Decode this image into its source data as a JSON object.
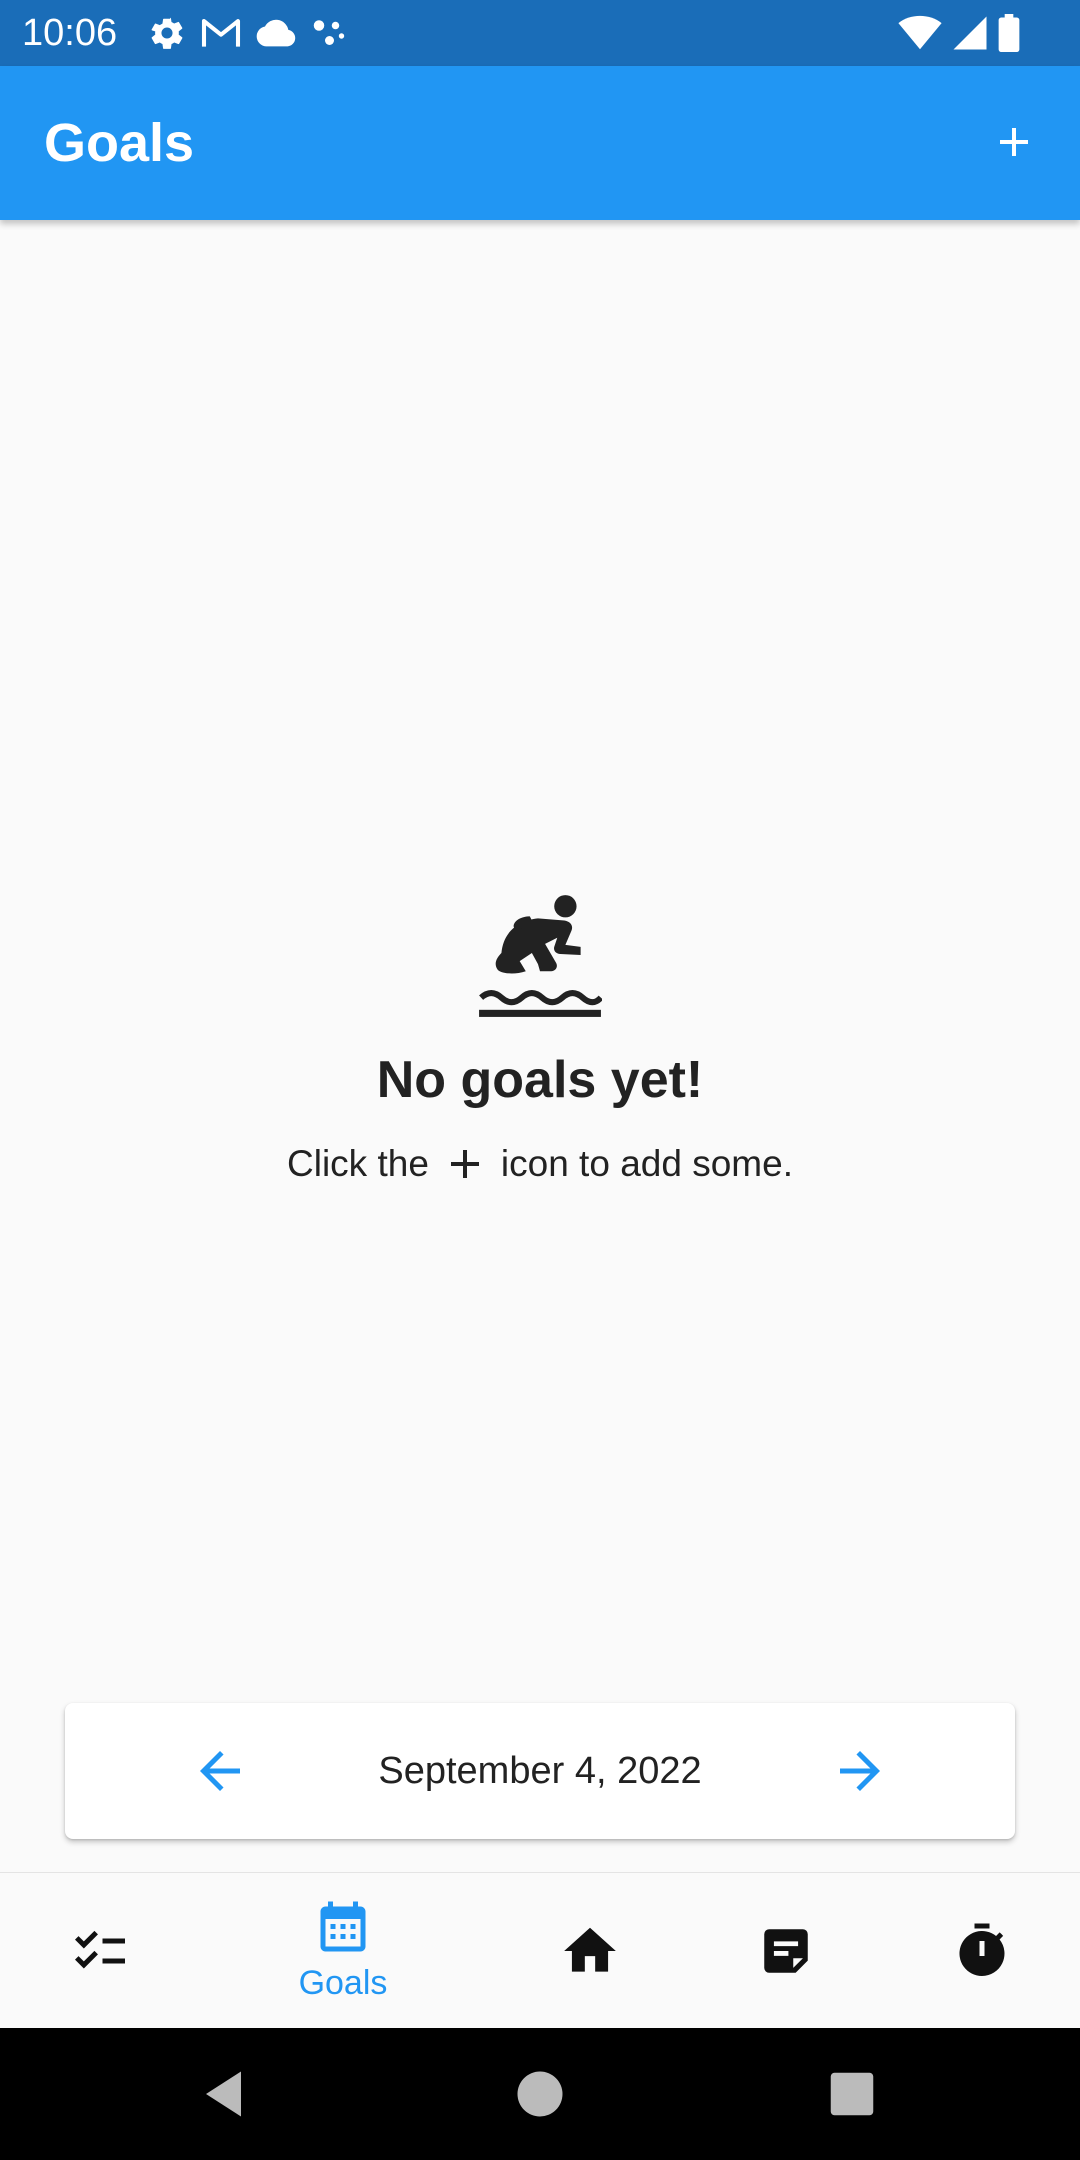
{
  "status_bar": {
    "time": "10:06",
    "left_icons": [
      "settings-icon",
      "gmail-icon",
      "cloud-icon",
      "assistant-icon"
    ],
    "right_icons": [
      "wifi-icon",
      "signal-icon",
      "battery-icon"
    ]
  },
  "app_bar": {
    "title": "Goals",
    "action_icon": "add-icon",
    "color": "#2196F3"
  },
  "empty_state": {
    "icon": "surfing-icon",
    "title": "No goals yet!",
    "subtitle_before": "Click the",
    "subtitle_icon": "add-icon",
    "subtitle_after": "icon to add some."
  },
  "date_navigator": {
    "date": "September 4, 2022",
    "prev_icon": "arrow-left-icon",
    "next_icon": "arrow-right-icon"
  },
  "bottom_nav": {
    "items": [
      {
        "icon": "checklist-icon",
        "label": "",
        "active": false
      },
      {
        "icon": "calendar-icon",
        "label": "Goals",
        "active": true
      },
      {
        "icon": "home-icon",
        "label": "",
        "active": false
      },
      {
        "icon": "note-icon",
        "label": "",
        "active": false
      },
      {
        "icon": "timer-icon",
        "label": "",
        "active": false
      }
    ],
    "active_color": "#2196F3"
  },
  "system_nav": {
    "buttons": [
      "back-icon",
      "home-circle-icon",
      "recents-icon"
    ]
  }
}
